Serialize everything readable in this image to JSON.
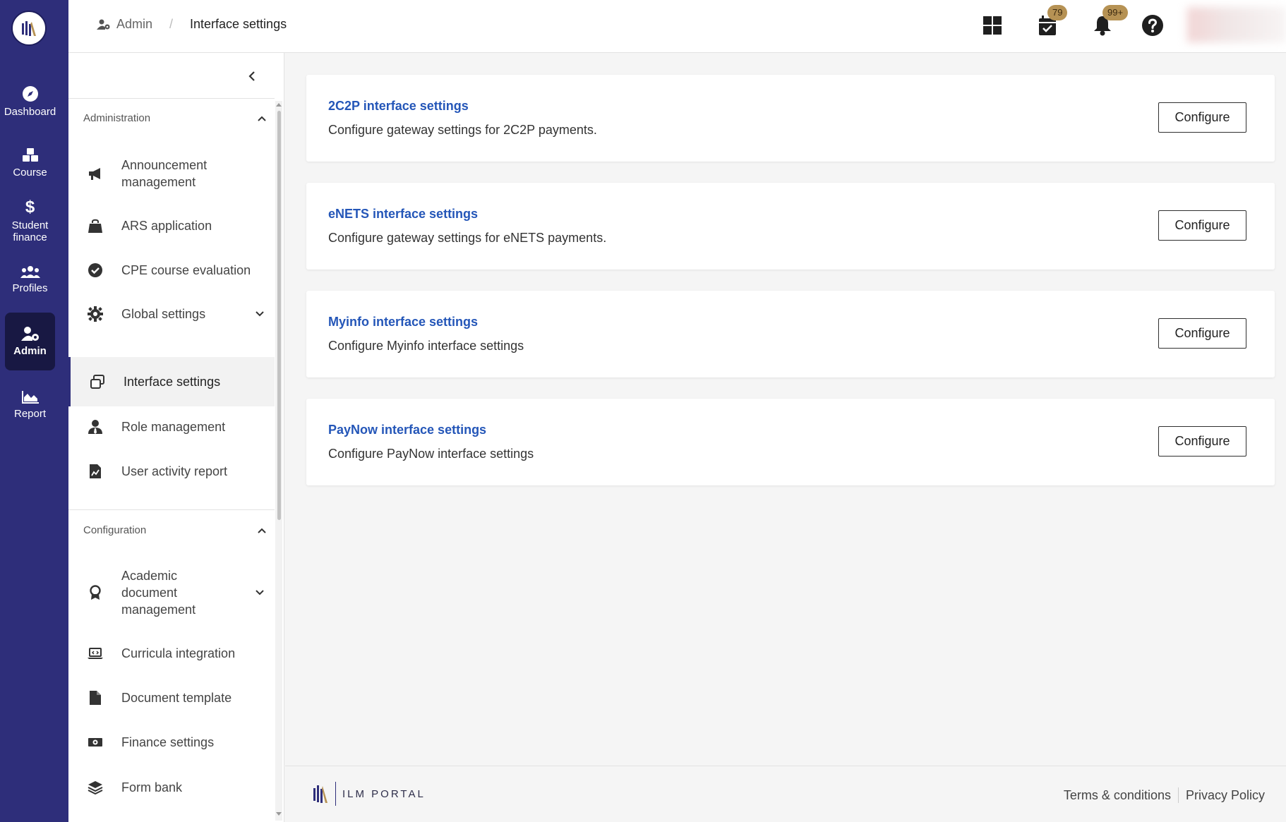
{
  "rail": {
    "items": [
      {
        "label": "Dashboard",
        "icon": "compass-icon"
      },
      {
        "label": "Course",
        "icon": "cubes-icon"
      },
      {
        "label": "Student finance",
        "icon": "dollar-icon"
      },
      {
        "label": "Profiles",
        "icon": "users-icon"
      },
      {
        "label": "Admin",
        "icon": "user-gear-icon",
        "active": true
      },
      {
        "label": "Report",
        "icon": "area-chart-icon"
      }
    ]
  },
  "breadcrumb": {
    "admin": "Admin",
    "separator": "/",
    "current": "Interface settings"
  },
  "topbar": {
    "calendar_badge": "79",
    "notification_badge": "99+"
  },
  "sidebar": {
    "administration": {
      "title": "Administration",
      "items": [
        {
          "label": "Announcement management",
          "icon": "megaphone-icon"
        },
        {
          "label": "ARS application",
          "icon": "bag-icon"
        },
        {
          "label": "CPE course evaluation",
          "icon": "check-circle-icon"
        },
        {
          "label": "Global settings",
          "icon": "gear-icon",
          "expandable": true
        },
        {
          "label": "Interface settings",
          "icon": "windows-icon",
          "active": true
        },
        {
          "label": "Role management",
          "icon": "user-tie-icon"
        },
        {
          "label": "User activity report",
          "icon": "file-chart-icon"
        }
      ]
    },
    "configuration": {
      "title": "Configuration",
      "items": [
        {
          "label": "Academic document management",
          "icon": "award-icon",
          "expandable": true
        },
        {
          "label": "Curricula integration",
          "icon": "laptop-code-icon"
        },
        {
          "label": "Document template",
          "icon": "file-icon"
        },
        {
          "label": "Finance settings",
          "icon": "money-icon"
        },
        {
          "label": "Form bank",
          "icon": "layers-icon"
        }
      ]
    }
  },
  "cards": [
    {
      "title": "2C2P interface settings",
      "description": "Configure gateway settings for 2C2P payments.",
      "button": "Configure"
    },
    {
      "title": "eNETS interface settings",
      "description": "Configure gateway settings for eNETS payments.",
      "button": "Configure"
    },
    {
      "title": "Myinfo interface settings",
      "description": "Configure Myinfo interface settings",
      "button": "Configure"
    },
    {
      "title": "PayNow interface settings",
      "description": "Configure PayNow interface settings",
      "button": "Configure"
    }
  ],
  "footer": {
    "brand": "ILM PORTAL",
    "terms": "Terms & conditions",
    "privacy": "Privacy Policy"
  },
  "colors": {
    "rail_bg": "#2e2e7a",
    "rail_active": "#181843",
    "link_blue": "#2456b8",
    "badge_gold": "#b69254"
  }
}
